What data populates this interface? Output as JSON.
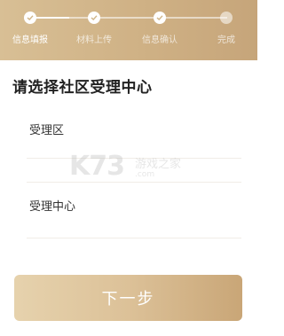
{
  "progress": {
    "steps": [
      {
        "label": "信息填报",
        "state": "done"
      },
      {
        "label": "材料上传",
        "state": "pending"
      },
      {
        "label": "信息确认",
        "state": "pending"
      },
      {
        "label": "完成",
        "state": "pending"
      }
    ],
    "completed_fraction": 0.2
  },
  "page": {
    "title": "请选择社区受理中心"
  },
  "options": [
    {
      "label": "受理区"
    },
    {
      "label": "受理中心"
    }
  ],
  "watermark": {
    "logo": "K73",
    "name": "游戏之家",
    "url": ".com"
  },
  "footer": {
    "next_label": "下一步"
  },
  "colors": {
    "header_gradient_start": "#d8bf95",
    "header_gradient_end": "#c6a57a",
    "button_gradient_start": "#e6d2ad",
    "button_gradient_end": "#c9a677"
  }
}
